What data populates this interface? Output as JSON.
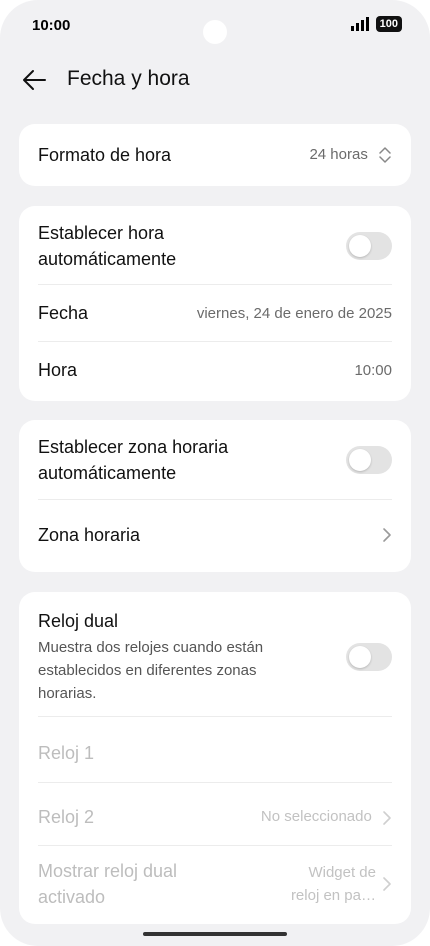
{
  "status": {
    "time": "10:00",
    "battery": "100"
  },
  "header": {
    "title": "Fecha y hora"
  },
  "time_format": {
    "label": "Formato de hora",
    "value": "24 horas"
  },
  "auto_time": {
    "label_line1": "Establecer hora",
    "label_line2": "automáticamente"
  },
  "date": {
    "label": "Fecha",
    "value": "viernes, 24 de enero de 2025"
  },
  "time": {
    "label": "Hora",
    "value": "10:00"
  },
  "auto_zone": {
    "label_line1": "Establecer zona horaria",
    "label_line2": "automáticamente"
  },
  "time_zone": {
    "label": "Zona horaria"
  },
  "dual_clock": {
    "label": "Reloj dual",
    "desc_line1": "Muestra dos relojes cuando están",
    "desc_line2": "establecidos en diferentes zonas",
    "desc_line3": "horarias."
  },
  "clock1": {
    "label": "Reloj 1"
  },
  "clock2": {
    "label": "Reloj 2",
    "value": "No seleccionado"
  },
  "show_dual": {
    "label_line1": "Mostrar reloj dual",
    "label_line2": "activado",
    "value_line1": "Widget de",
    "value_line2": "reloj en pa…"
  },
  "colors": {
    "background": "#f1f1f3",
    "card": "#ffffff",
    "toggle_off": "#e3e3e3"
  }
}
